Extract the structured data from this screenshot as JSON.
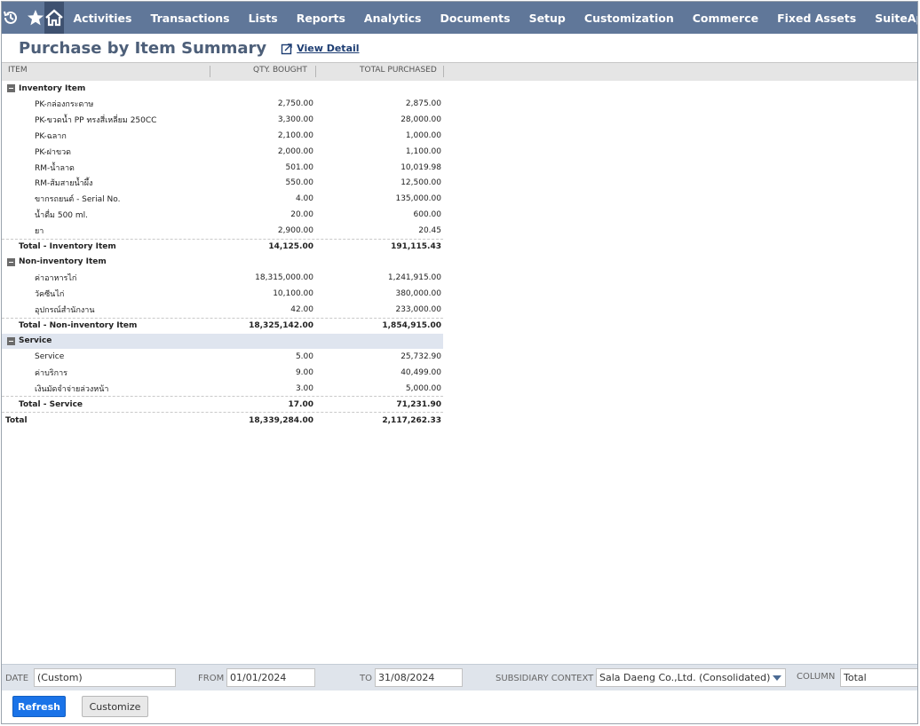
{
  "nav": {
    "icons": [
      "recent-icon",
      "star-icon",
      "home-icon"
    ],
    "items": [
      "Activities",
      "Transactions",
      "Lists",
      "Reports",
      "Analytics",
      "Documents",
      "Setup",
      "Customization",
      "Commerce",
      "Fixed Assets",
      "SuiteApps"
    ]
  },
  "page": {
    "title": "Purchase by Item Summary",
    "view_detail": "View Detail"
  },
  "table": {
    "columns": [
      "ITEM",
      "QTY. BOUGHT",
      "TOTAL PURCHASED"
    ],
    "groups": [
      {
        "name": "Inventory Item",
        "shaded": false,
        "rows": [
          {
            "item": "PK-กล่องกระดาษ",
            "qty": "2,750.00",
            "total": "2,875.00"
          },
          {
            "item": "PK-ขวดน้ำ PP ทรงสี่เหลี่ยม 250CC",
            "qty": "3,300.00",
            "total": "28,000.00"
          },
          {
            "item": "PK-ฉลาก",
            "qty": "2,100.00",
            "total": "1,000.00"
          },
          {
            "item": "PK-ฝาขวด",
            "qty": "2,000.00",
            "total": "1,100.00"
          },
          {
            "item": "RM-น้ำลาด",
            "qty": "501.00",
            "total": "10,019.98"
          },
          {
            "item": "RM-ส้มสายน้ำผึ้ง",
            "qty": "550.00",
            "total": "12,500.00"
          },
          {
            "item": "ขากรถยนต์ - Serial No.",
            "qty": "4.00",
            "total": "135,000.00"
          },
          {
            "item": "น้ำดื่ม 500 ml.",
            "qty": "20.00",
            "total": "600.00"
          },
          {
            "item": "ยา",
            "qty": "2,900.00",
            "total": "20.45"
          }
        ],
        "total_label": "Total - Inventory Item",
        "total_qty": "14,125.00",
        "total_amount": "191,115.43"
      },
      {
        "name": "Non-inventory Item",
        "shaded": false,
        "rows": [
          {
            "item": "ค่าอาหารไก่",
            "qty": "18,315,000.00",
            "total": "1,241,915.00"
          },
          {
            "item": "วัคซีนไก่",
            "qty": "10,100.00",
            "total": "380,000.00"
          },
          {
            "item": "อุปกรณ์สำนักงาน",
            "qty": "42.00",
            "total": "233,000.00"
          }
        ],
        "total_label": "Total - Non-inventory Item",
        "total_qty": "18,325,142.00",
        "total_amount": "1,854,915.00"
      },
      {
        "name": "Service",
        "shaded": true,
        "rows": [
          {
            "item": "Service",
            "qty": "5.00",
            "total": "25,732.90"
          },
          {
            "item": "ค่าบริการ",
            "qty": "9.00",
            "total": "40,499.00"
          },
          {
            "item": "เงินมัดจำจ่ายล่วงหน้า",
            "qty": "3.00",
            "total": "5,000.00"
          }
        ],
        "total_label": "Total - Service",
        "total_qty": "17.00",
        "total_amount": "71,231.90"
      }
    ],
    "grand_total_label": "Total",
    "grand_total_qty": "18,339,284.00",
    "grand_total_amount": "2,117,262.33"
  },
  "filters": {
    "date_label": "DATE",
    "date_value": "(Custom)",
    "from_label": "FROM",
    "from_value": "01/01/2024",
    "to_label": "TO",
    "to_value": "31/08/2024",
    "subsidiary_label": "SUBSIDIARY CONTEXT",
    "subsidiary_value": "Sala Daeng Co.,Ltd. (Consolidated)",
    "column_label": "COLUMN",
    "column_value": "Total"
  },
  "buttons": {
    "refresh": "Refresh",
    "customize": "Customize"
  },
  "colors": {
    "nav_bg": "#607799",
    "nav_active": "#3e5170",
    "title": "#4d5f79",
    "refresh": "#1a73e8",
    "filter_bar": "#dfe4eb",
    "shaded_group": "#dfe5ef"
  }
}
